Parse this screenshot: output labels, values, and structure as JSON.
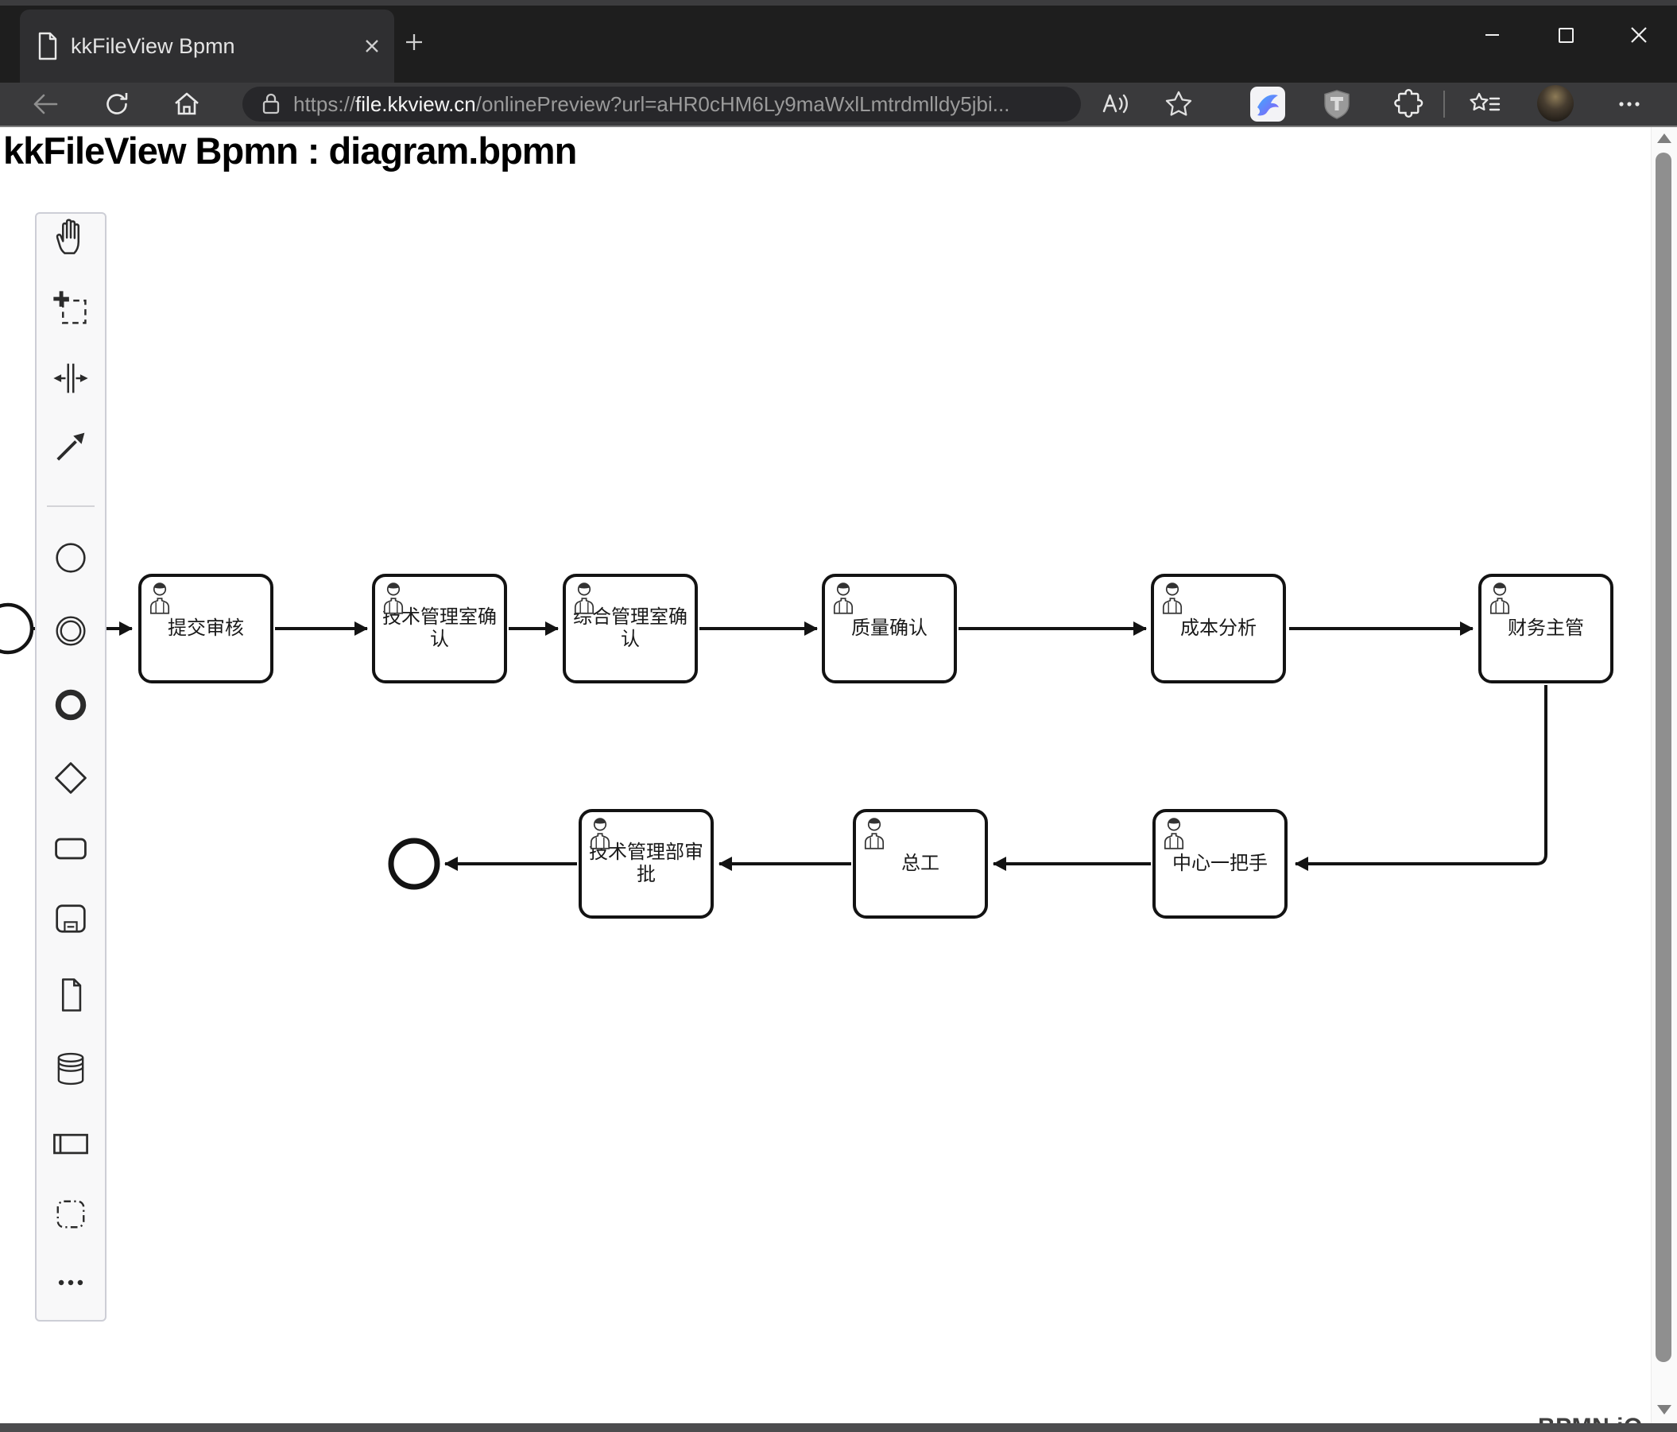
{
  "browser": {
    "tab_title": "kkFileView Bpmn",
    "url": {
      "scheme": "https://",
      "host": "file.kkview.cn",
      "path": "/onlinePreview?url=aHR0cHM6Ly9maWxlLmtrdmlldy5jbi..."
    }
  },
  "page": {
    "title": "kkFileView Bpmn : diagram.bpmn",
    "watermark": "BPMN.iO"
  },
  "palette": {
    "tools": [
      "hand-tool",
      "lasso-tool",
      "space-tool",
      "global-connect-tool",
      "create-start-event",
      "create-intermediate-event",
      "create-end-event",
      "create-gateway",
      "create-task",
      "create-subprocess",
      "create-data-object",
      "create-data-store",
      "create-participant",
      "create-group",
      "more-options"
    ]
  },
  "diagram": {
    "tasks": [
      {
        "label": "提交审核"
      },
      {
        "label": "技术管理室确认"
      },
      {
        "label": "综合管理室确认"
      },
      {
        "label": "质量确认"
      },
      {
        "label": "成本分析"
      },
      {
        "label": "财务主管"
      },
      {
        "label": "中心一把手"
      },
      {
        "label": "总工"
      },
      {
        "label": "技术管理部审批"
      }
    ]
  },
  "colors": {
    "titlebar": "#1e1e1e",
    "toolbar": "#3a3a3c",
    "tab": "#2f2f31",
    "url_pill": "#27272a",
    "page_bg": "#ffffff",
    "diagram_stroke": "#131313",
    "palette_bg": "#f8f8f9",
    "scrollbar_thumb": "#8f8f8f",
    "bottom_bar": "#4c4c4e"
  }
}
